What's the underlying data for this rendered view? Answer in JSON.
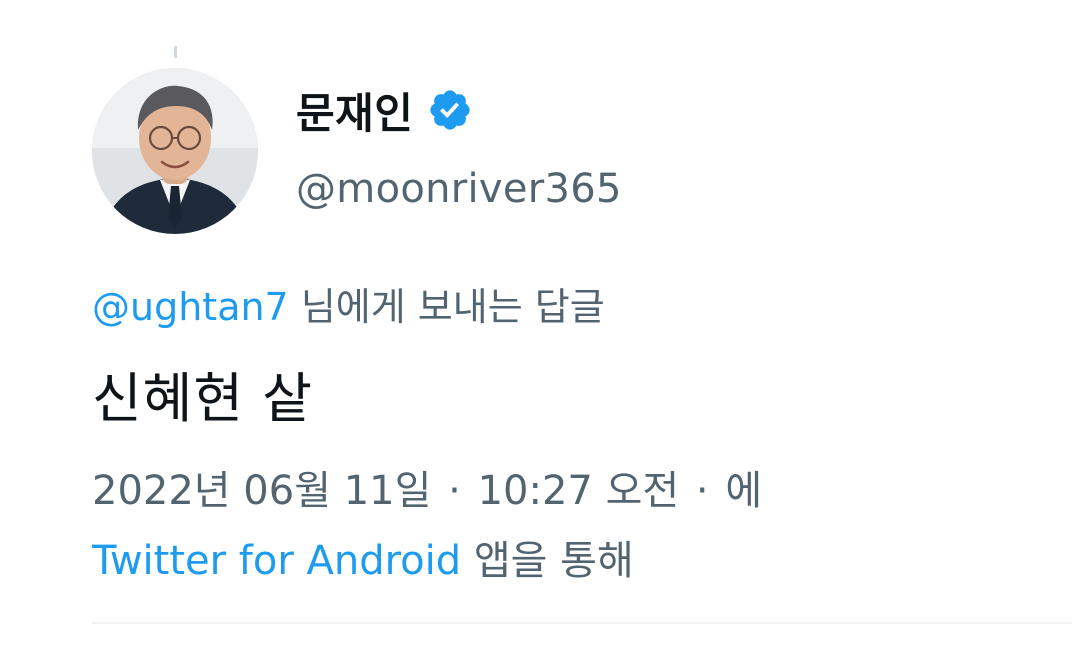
{
  "author": {
    "display_name": "문재인",
    "handle": "@moonriver365",
    "verified_icon": "verified-badge-icon",
    "avatar_icon": "profile-photo"
  },
  "reply": {
    "mention": "@ughtan7",
    "suffix": " 님에게 보내는 답글"
  },
  "tweet": {
    "text": "신혜현 샅"
  },
  "meta": {
    "date": "2022년 06월 11일",
    "separator": "·",
    "time": "10:27 오전",
    "via_prefix": "에",
    "source": "Twitter for Android",
    "source_suffix": " 앱을 통해"
  },
  "colors": {
    "link": "#1d9bf0",
    "secondary_text": "#536471",
    "primary_text": "#0f1419",
    "divider": "#eff3f4"
  }
}
